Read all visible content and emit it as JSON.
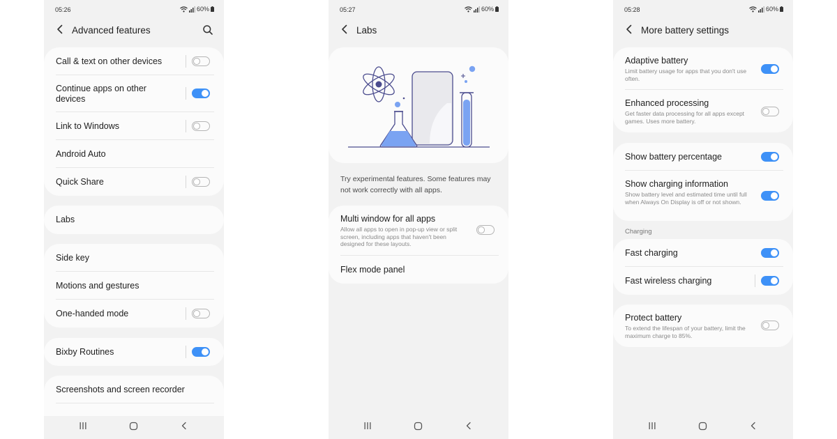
{
  "screens": [
    {
      "status": {
        "time": "05:26",
        "battery": "60%"
      },
      "title": "Advanced features",
      "groups": [
        {
          "rows": [
            {
              "label": "Call & text on other devices",
              "toggle": "off"
            },
            {
              "label": "Continue apps on other devices",
              "toggle": "on"
            },
            {
              "label": "Link to Windows",
              "toggle": "off"
            },
            {
              "label": "Android Auto"
            },
            {
              "label": "Quick Share",
              "toggle": "off"
            }
          ]
        },
        {
          "rows": [
            {
              "label": "Labs"
            }
          ]
        },
        {
          "rows": [
            {
              "label": "Side key"
            },
            {
              "label": "Motions and gestures"
            },
            {
              "label": "One-handed mode",
              "toggle": "off"
            }
          ]
        },
        {
          "rows": [
            {
              "label": "Bixby Routines",
              "toggle": "on"
            }
          ]
        },
        {
          "rows": [
            {
              "label": "Screenshots and screen recorder"
            }
          ]
        }
      ]
    },
    {
      "status": {
        "time": "05:27",
        "battery": "60%"
      },
      "title": "Labs",
      "intro": "Try experimental features. Some features may not work correctly with all apps.",
      "rows": [
        {
          "label": "Multi window for all apps",
          "sub": "Allow all apps to open in pop-up view or split screen, including apps that haven't been designed for these layouts.",
          "toggle": "off"
        },
        {
          "label": "Flex mode panel"
        }
      ]
    },
    {
      "status": {
        "time": "05:28",
        "battery": "60%"
      },
      "title": "More battery settings",
      "groups": [
        {
          "rows": [
            {
              "label": "Adaptive battery",
              "sub": "Limit battery usage for apps that you don't use often.",
              "toggle": "on"
            },
            {
              "label": "Enhanced processing",
              "sub": "Get faster data processing for all apps except games. Uses more battery.",
              "toggle": "off"
            }
          ]
        },
        {
          "rows": [
            {
              "label": "Show battery percentage",
              "toggle": "on"
            },
            {
              "label": "Show charging information",
              "sub": "Show battery level and estimated time until full when Always On Display is off or not shown.",
              "toggle": "on"
            }
          ]
        },
        {
          "header": "Charging",
          "rows": [
            {
              "label": "Fast charging",
              "toggle": "on"
            },
            {
              "label": "Fast wireless charging",
              "toggle": "on"
            }
          ]
        },
        {
          "rows": [
            {
              "label": "Protect battery",
              "sub": "To extend the lifespan of your battery, limit the maximum charge to 85%.",
              "toggle": "off"
            }
          ]
        }
      ]
    }
  ],
  "icons": {
    "back": "chevron-left-icon",
    "search": "search-icon",
    "nav": [
      "recents-icon",
      "home-icon",
      "back-icon"
    ]
  },
  "colors": {
    "accent": "#3e91f7",
    "background": "#f2f2f2",
    "card": "#fbfbfb",
    "illustration": "#4b4c8e"
  }
}
